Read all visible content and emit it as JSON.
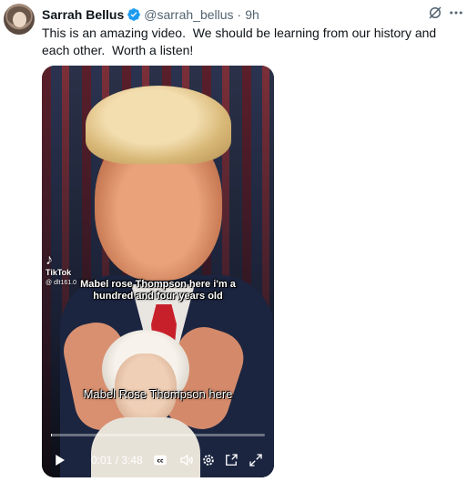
{
  "tweet": {
    "author_name": "Sarrah Bellus",
    "handle": "@sarrah_bellus",
    "separator": "·",
    "time": "9h",
    "text": "This is an amazing video.  We should be learning from our history and each other.  Worth a listen!"
  },
  "video": {
    "watermark_brand": "TikTok",
    "watermark_user": "@ dlt161.0",
    "caption_top": "Mabel rose Thompson here i'm a hundred and four years old",
    "caption_bottom": "Mabel Rose Thompson here",
    "current_time": "0:01",
    "time_separator": " / ",
    "duration": "3:48",
    "progress_fraction": 0.004
  },
  "icons": {
    "verified": "verified-badge-icon",
    "grok": "grok-icon",
    "more": "more-icon",
    "play": "play-icon",
    "cc": "captions-icon",
    "volume": "volume-icon",
    "settings": "settings-icon",
    "pip": "picture-in-picture-icon",
    "fullscreen": "fullscreen-icon"
  },
  "colors": {
    "accent": "#1d9bf0",
    "text": "#0f1419",
    "muted": "#536471"
  }
}
